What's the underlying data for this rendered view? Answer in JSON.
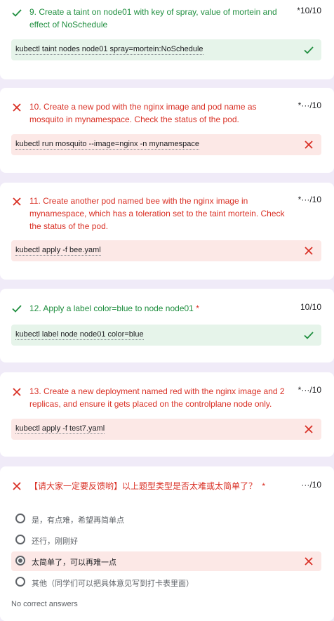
{
  "questions": [
    {
      "text": "9. Create a taint on node01 with key of spray, value of mortein and effect of NoSchedule",
      "score": "*10/10",
      "status": "correct",
      "answer": "kubectl taint nodes node01 spray=mortein:NoSchedule"
    },
    {
      "text": "10. Create a new pod with the nginx image and pod name as mosquito in mynamespace. Check the status of the pod.",
      "score": "*···/10",
      "status": "wrong",
      "answer": "kubectl run mosquito --image=nginx -n mynamespace"
    },
    {
      "text": "11. Create another pod named bee with the nginx image in mynamespace, which has a toleration set to the taint mortein. Check the status of the pod.",
      "score": "*···/10",
      "status": "wrong",
      "answer": "kubectl apply -f bee.yaml"
    },
    {
      "text": "12. Apply a label color=blue to node node01",
      "required": "*",
      "score": "10/10",
      "status": "correct",
      "answer": "kubectl label node node01 color=blue"
    },
    {
      "text": "13. Create a new deployment named red with the nginx image and 2 replicas, and ensure it gets placed on the controlplane node only.",
      "score": "*···/10",
      "status": "wrong",
      "answer": "kubectl apply -f test7.yaml"
    }
  ],
  "survey": {
    "text": "【请大家一定要反馈哟】以上题型类型是否太难或太简单了？",
    "required": "*",
    "score": "···/10",
    "options": [
      "是，有点难，希望再简单点",
      "还行，刚刚好",
      "太简单了，可以再难一点",
      "其他（同学们可以把具体意见写到打卡表里面）"
    ],
    "selected_option": "太简单了，可以再难一点",
    "footer": "No correct answers"
  },
  "colors": {
    "correct": "#1e8e3e",
    "wrong": "#d93025",
    "correct_bg": "#e6f4ea",
    "wrong_bg": "#fce8e6"
  }
}
